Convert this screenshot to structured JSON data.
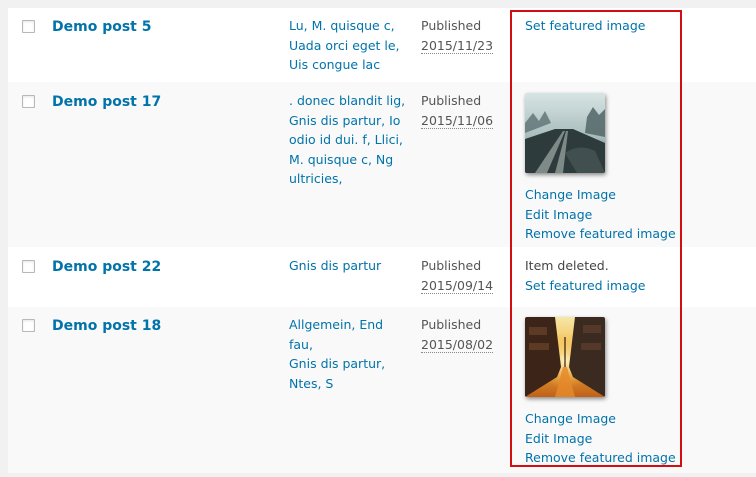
{
  "rows": [
    {
      "title": "Demo post 5",
      "categories": [
        "Lu, M. quisque c,",
        "Uada orci eget le,",
        "Uis congue lac"
      ],
      "status": "Published",
      "date": "2015/11/23",
      "featured": {
        "set": "Set featured image"
      }
    },
    {
      "title": "Demo post 17",
      "categories": [
        ". donec blandit lig,",
        "Gnis dis partur, Io",
        "odio id dui. f, Llici,",
        "M. quisque c, Ng",
        "ultricies,"
      ],
      "status": "Published",
      "date": "2015/11/06",
      "featured": {
        "thumbnail": "misty-railway-track-thumbnail",
        "change": "Change Image",
        "edit": "Edit Image",
        "remove": "Remove featured image"
      }
    },
    {
      "title": "Demo post 22",
      "categories": [
        "Gnis dis partur"
      ],
      "status": "Published",
      "date": "2015/09/14",
      "featured": {
        "message": "Item deleted.",
        "set": "Set featured image"
      }
    },
    {
      "title": "Demo post 18",
      "categories": [
        "Allgemein, End fau,",
        "Gnis dis partur,",
        "Ntes, S"
      ],
      "status": "Published",
      "date": "2015/08/02",
      "featured": {
        "thumbnail": "sunset-city-street-thumbnail",
        "change": "Change Image",
        "edit": "Edit Image",
        "remove": "Remove featured image"
      }
    }
  ],
  "colors": {
    "link": "#0073aa",
    "highlight_border": "#d10f13",
    "row_alt": "#f9f9f9"
  }
}
